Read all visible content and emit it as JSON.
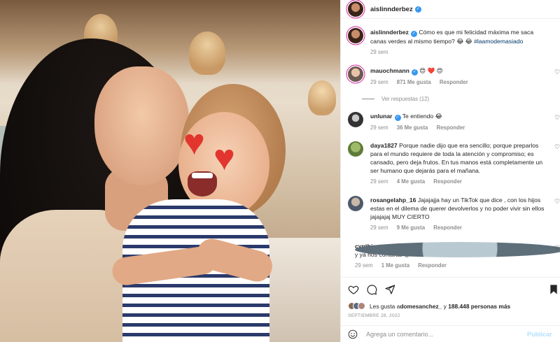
{
  "post": {
    "author": "aislinnderbez",
    "caption_text": "Cómo es que mi felicidad máxima me saca canas verdes al mismo tiempo? 😂 😂 ",
    "caption_hashtag": "#laamodemasiado",
    "caption_time": "29 sem"
  },
  "comments": [
    {
      "user": "mauochmann",
      "text": " 😍 ❤️ 😍",
      "time": "29 sem",
      "likes": "871 Me gusta",
      "reply": "Responder"
    },
    {
      "user": "unlunar",
      "text": " Te entiendo 😂",
      "time": "29 sem",
      "likes": "36 Me gusta",
      "reply": "Responder"
    },
    {
      "user": "daya1827",
      "text": " Porque nadie dijo que era sencillo; porque preparlos para el mundo requiere de toda la atención y compromiso; es cansado, pero deja frutos. En tus manos está completamente un ser humano que dejarás para el mañana.",
      "time": "29 sem",
      "likes": "4 Me gusta",
      "reply": "Responder"
    },
    {
      "user": "rosangelahp_16",
      "text": " Jajajajja hay un TikTok que dice , con los hijos estas en el dilema de querer devolverlos y no poder vivir sin ellos jajajajaj MUY CIERTO",
      "time": "29 sem",
      "likes": "9 Me gusta",
      "reply": "Responder"
    },
    {
      "user": "cynthia.mat1517",
      "text": " 😂  Sí estás en la gloria. Deja que sea teenager y ya nos contarás 😍",
      "time": "29 sem",
      "likes": "1 Me gusta",
      "reply": "Responder"
    }
  ],
  "view_replies": "Ver respuestas (12)",
  "likes": {
    "prefix": "Les gusta a ",
    "user": "domesanchez_",
    "middle": " y ",
    "count": "188.448 personas más"
  },
  "date": "SEPTIEMBRE 28, 2022",
  "add_comment": {
    "placeholder": "Agrega un comentario...",
    "publish": "Publicar"
  },
  "icons": {
    "like": "heart-icon",
    "comment": "comment-icon",
    "share": "send-icon",
    "save": "bookmark-icon",
    "emoji": "emoji-icon",
    "verified": "verified-badge-icon"
  },
  "colors": {
    "link": "#00376b",
    "verified": "#3897f0",
    "muted": "#8e8e8e",
    "publish": "#b2dffc"
  }
}
